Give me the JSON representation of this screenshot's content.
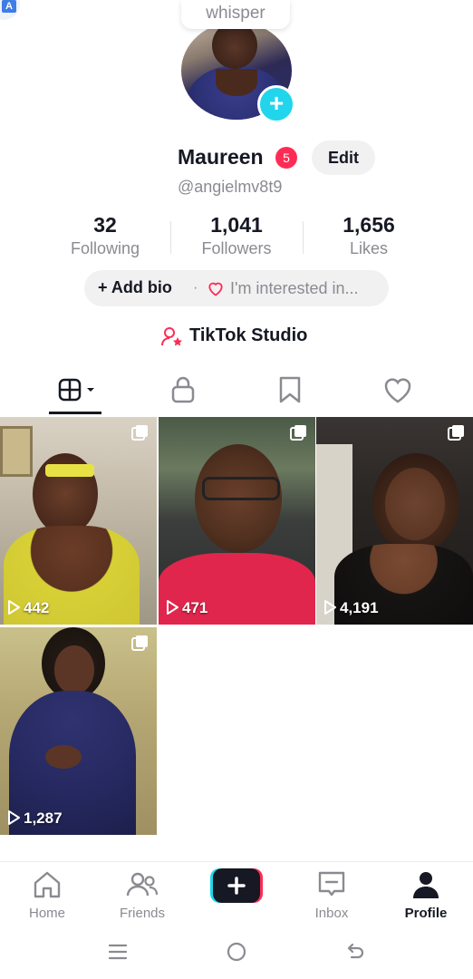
{
  "corner": {
    "badge_text": "A"
  },
  "profile": {
    "whisper": "whisper",
    "name": "Maureen",
    "notifications": "5",
    "edit_label": "Edit",
    "handle": "@angielmv8t9"
  },
  "stats": [
    {
      "value": "32",
      "label": "Following"
    },
    {
      "value": "1,041",
      "label": "Followers"
    },
    {
      "value": "1,656",
      "label": "Likes"
    }
  ],
  "bio": {
    "add_bio": "+ Add bio",
    "separator": "·",
    "interest": "I'm interested in..."
  },
  "studio": {
    "label": "TikTok Studio"
  },
  "tabs": [
    {
      "icon": "grid-icon",
      "active": true
    },
    {
      "icon": "lock-icon",
      "active": false
    },
    {
      "icon": "bookmark-icon",
      "active": false
    },
    {
      "icon": "heart-icon",
      "active": false
    }
  ],
  "videos": [
    {
      "views": "442"
    },
    {
      "views": "471"
    },
    {
      "views": "4,191"
    },
    {
      "views": "1,287"
    }
  ],
  "nav": [
    {
      "label": "Home",
      "icon": "home-icon"
    },
    {
      "label": "Friends",
      "icon": "friends-icon"
    },
    {
      "label": "",
      "icon": "create-icon"
    },
    {
      "label": "Inbox",
      "icon": "inbox-icon"
    },
    {
      "label": "Profile",
      "icon": "profile-icon",
      "active": true
    }
  ],
  "colors": {
    "accent": "#fe2c55",
    "cyan": "#20d5ec",
    "text": "#161823",
    "muted": "#8a8b91"
  }
}
